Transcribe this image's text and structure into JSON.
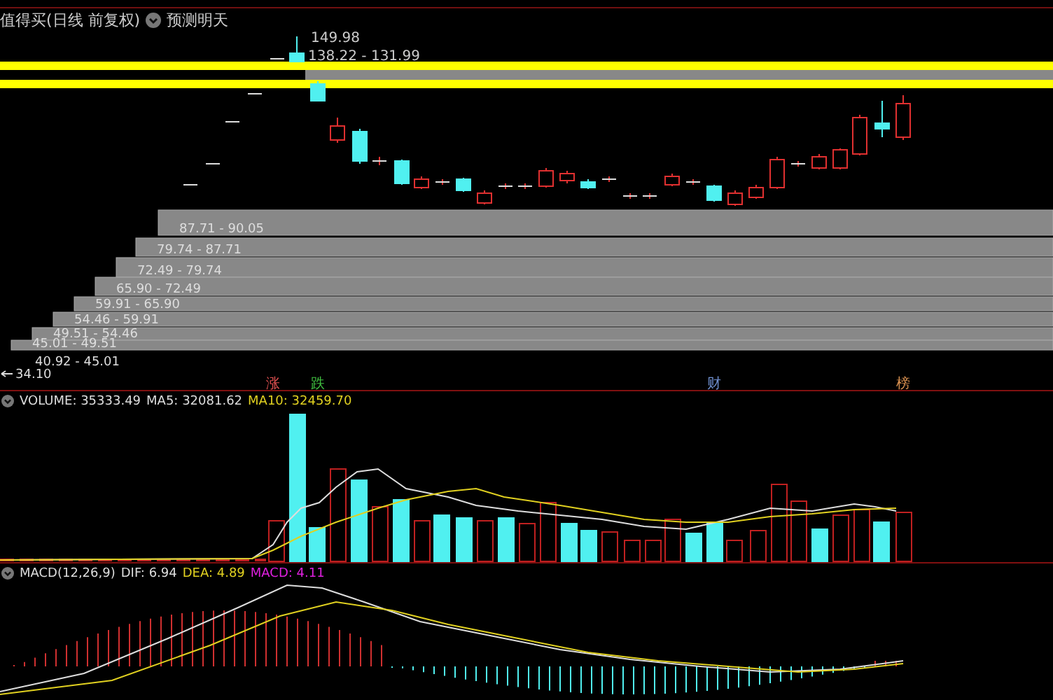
{
  "header": {
    "title": "值得买(日线 前复权)",
    "forecast": "预测明天"
  },
  "price_labels": {
    "high": "149.98",
    "range": "138.22 - 131.99",
    "low": "34.10"
  },
  "chips": [
    {
      "label": "87.71 - 90.05",
      "kind": "bar"
    },
    {
      "label": "79.74 - 87.71",
      "kind": "bar"
    },
    {
      "label": "72.49 - 79.74",
      "kind": "bar"
    },
    {
      "label": "65.90 - 72.49",
      "kind": "bar"
    },
    {
      "label": "59.91 - 65.90",
      "kind": "bar"
    },
    {
      "label": "54.46 - 59.91",
      "kind": "bar"
    },
    {
      "label": "49.51 - 54.46",
      "kind": "bar"
    },
    {
      "label": "45.01 - 49.51",
      "kind": "bar"
    },
    {
      "label": "40.92 - 45.01",
      "kind": "text"
    }
  ],
  "markers": [
    {
      "text": "涨",
      "color": "#e05050"
    },
    {
      "text": "跌",
      "color": "#40c040"
    },
    {
      "text": "财",
      "color": "#7090d0"
    },
    {
      "text": "榜",
      "color": "#d89050"
    }
  ],
  "volume": {
    "name": "VOLUME: 35333.49",
    "ma5": "MA5: 32081.62",
    "ma10": "MA10: 32459.70"
  },
  "macd": {
    "name": "MACD(12,26,9)",
    "dif": "DIF: 6.94",
    "dea": "DEA: 4.89",
    "macd": "MACD: 4.11"
  }
}
